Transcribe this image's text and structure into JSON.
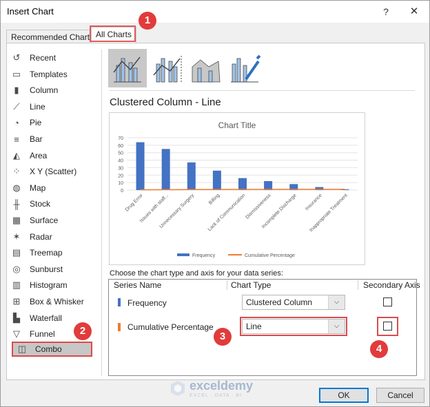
{
  "dialog": {
    "title": "Insert Chart",
    "help": "?",
    "close": "✕"
  },
  "tabs": [
    {
      "label": "Recommended Charts"
    },
    {
      "label": "All Charts"
    }
  ],
  "sidebar": {
    "items": [
      {
        "label": "Recent",
        "icon": "recent-icon"
      },
      {
        "label": "Templates",
        "icon": "templates-icon"
      },
      {
        "label": "Column",
        "icon": "column-chart-icon"
      },
      {
        "label": "Line",
        "icon": "line-chart-icon"
      },
      {
        "label": "Pie",
        "icon": "pie-chart-icon"
      },
      {
        "label": "Bar",
        "icon": "bar-chart-icon"
      },
      {
        "label": "Area",
        "icon": "area-chart-icon"
      },
      {
        "label": "X Y (Scatter)",
        "icon": "scatter-chart-icon"
      },
      {
        "label": "Map",
        "icon": "map-chart-icon"
      },
      {
        "label": "Stock",
        "icon": "stock-chart-icon"
      },
      {
        "label": "Surface",
        "icon": "surface-chart-icon"
      },
      {
        "label": "Radar",
        "icon": "radar-chart-icon"
      },
      {
        "label": "Treemap",
        "icon": "treemap-chart-icon"
      },
      {
        "label": "Sunburst",
        "icon": "sunburst-chart-icon"
      },
      {
        "label": "Histogram",
        "icon": "histogram-chart-icon"
      },
      {
        "label": "Box & Whisker",
        "icon": "box-whisker-chart-icon"
      },
      {
        "label": "Waterfall",
        "icon": "waterfall-chart-icon"
      },
      {
        "label": "Funnel",
        "icon": "funnel-chart-icon"
      },
      {
        "label": "Combo",
        "icon": "combo-chart-icon",
        "selected": true
      }
    ]
  },
  "badges": [
    "1",
    "2",
    "3",
    "4"
  ],
  "combo": {
    "title": "Clustered Column - Line",
    "choose_label": "Choose the chart type and axis for your data series:",
    "headers": {
      "series": "Series Name",
      "type": "Chart Type",
      "axis": "Secondary Axis"
    },
    "series": [
      {
        "name": "Frequency",
        "color": "#4472c4",
        "type": "Clustered Column",
        "secondary": false
      },
      {
        "name": "Cumulative Percentage",
        "color": "#ed7d31",
        "type": "Line",
        "secondary": false
      }
    ]
  },
  "buttons": {
    "ok": "OK",
    "cancel": "Cancel"
  },
  "watermark": {
    "name": "exceldemy",
    "sub": "EXCEL · DATA · BI"
  },
  "chart_data": {
    "type": "bar",
    "title": "Chart Title",
    "categories": [
      "Drug Error",
      "Issues with staff...",
      "Unnecessary Surgery",
      "Billing",
      "Lack of Communication",
      "Dismissiveness",
      "Incomplete Discharge",
      "Insurance",
      "Inappropriate Treatment"
    ],
    "series": [
      {
        "name": "Frequency",
        "kind": "column",
        "color": "#4472c4",
        "values": [
          64,
          55,
          37,
          26,
          16,
          12,
          8,
          4,
          1
        ]
      },
      {
        "name": "Cumulative Percentage",
        "kind": "line",
        "color": "#ed7d31",
        "values": [
          0.29,
          0.55,
          0.72,
          0.84,
          0.91,
          0.96,
          0.99,
          1.0,
          1.0
        ]
      }
    ],
    "yticks": [
      "0",
      "10",
      "20",
      "30",
      "40",
      "50",
      "60",
      "70"
    ],
    "ylim": [
      0,
      70
    ],
    "grid": true,
    "legend": "bottom"
  }
}
